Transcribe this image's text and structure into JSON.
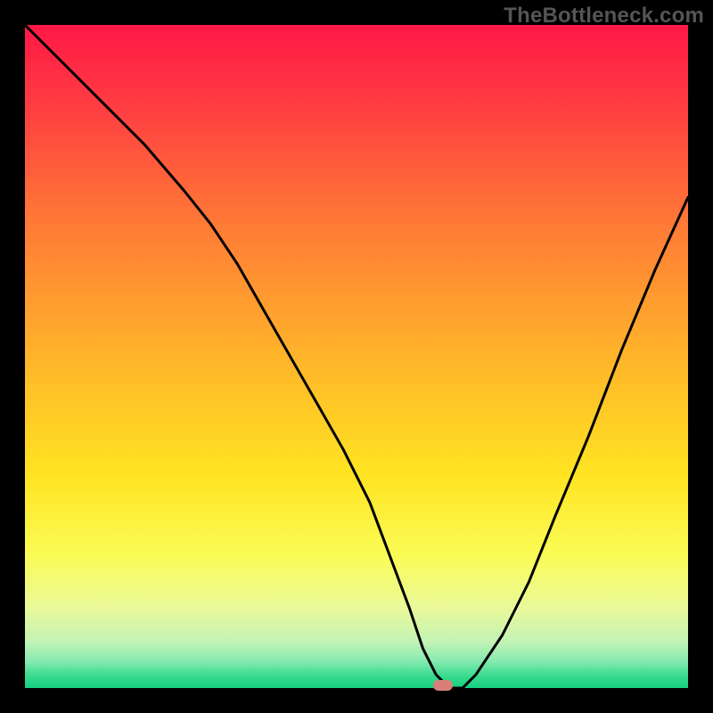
{
  "watermark": {
    "text": "TheBottleneck.com"
  },
  "marker": {
    "color": "#d97f7a",
    "x_pct": 63,
    "y_pct": 100
  },
  "gradient": {
    "stops": [
      {
        "pct": 0,
        "color": "#ff1846"
      },
      {
        "pct": 12,
        "color": "#ff3c42"
      },
      {
        "pct": 30,
        "color": "#ff7a36"
      },
      {
        "pct": 50,
        "color": "#ffb42a"
      },
      {
        "pct": 68,
        "color": "#ffe422"
      },
      {
        "pct": 80,
        "color": "#fafc56"
      },
      {
        "pct": 88,
        "color": "#e9f99a"
      },
      {
        "pct": 93,
        "color": "#c3f3b5"
      },
      {
        "pct": 96,
        "color": "#85eab0"
      },
      {
        "pct": 98,
        "color": "#3edc90"
      },
      {
        "pct": 100,
        "color": "#14cf80"
      }
    ]
  },
  "chart_data": {
    "type": "line",
    "title": "",
    "xlabel": "",
    "ylabel": "",
    "xlim": [
      0,
      100
    ],
    "ylim": [
      0,
      100
    ],
    "series": [
      {
        "name": "bottleneck-curve",
        "x": [
          0,
          6,
          12,
          18,
          24,
          28,
          32,
          36,
          40,
          44,
          48,
          52,
          55,
          58,
          60,
          62,
          64,
          66,
          68,
          72,
          76,
          80,
          85,
          90,
          95,
          100
        ],
        "y": [
          100,
          94,
          88,
          82,
          75,
          70,
          64,
          57,
          50,
          43,
          36,
          28,
          20,
          12,
          6,
          2,
          0,
          0,
          2,
          8,
          16,
          26,
          38,
          51,
          63,
          74
        ]
      }
    ],
    "annotations": [
      {
        "type": "marker",
        "x": 63,
        "y": 0,
        "label": "optimal-point"
      }
    ]
  }
}
